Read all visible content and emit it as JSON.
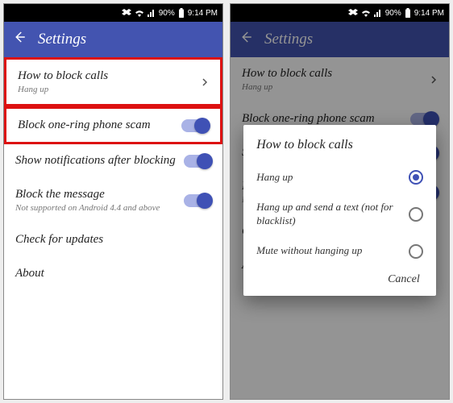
{
  "status": {
    "battery": "90%",
    "time": "9:14 PM"
  },
  "header": {
    "title": "Settings"
  },
  "settings": [
    {
      "title": "How to block calls",
      "sub": "Hang up",
      "control": "chevron",
      "highlight": true
    },
    {
      "title": "Block one-ring phone scam",
      "sub": "",
      "control": "toggle",
      "highlight": true
    },
    {
      "title": "Show notifications after blocking",
      "sub": "",
      "control": "toggle",
      "highlight": false
    },
    {
      "title": "Block the message",
      "sub": "Not supported on Android 4.4 and above",
      "control": "toggle",
      "highlight": false
    },
    {
      "title": "Check for updates",
      "sub": "",
      "control": "none",
      "highlight": false
    },
    {
      "title": "About",
      "sub": "",
      "control": "none",
      "highlight": false
    }
  ],
  "dialog": {
    "title": "How to block calls",
    "options": [
      {
        "label": "Hang up",
        "selected": true
      },
      {
        "label": "Hang up and send a text (not for blacklist)",
        "selected": false
      },
      {
        "label": "Mute without hanging up",
        "selected": false
      }
    ],
    "cancel": "Cancel"
  }
}
